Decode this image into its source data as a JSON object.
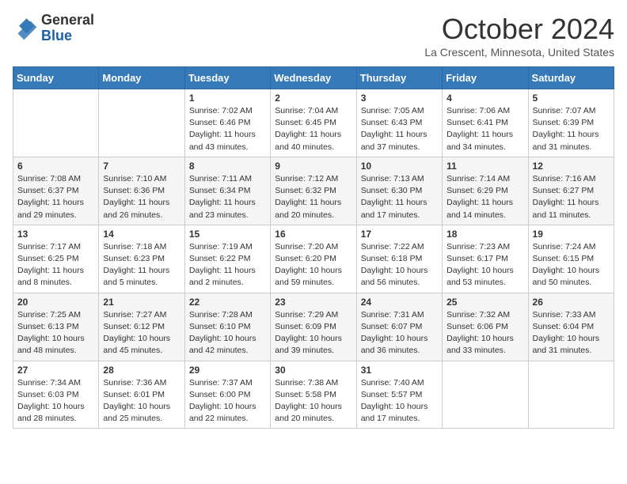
{
  "header": {
    "logo": {
      "line1": "General",
      "line2": "Blue"
    },
    "title": "October 2024",
    "location": "La Crescent, Minnesota, United States"
  },
  "days_of_week": [
    "Sunday",
    "Monday",
    "Tuesday",
    "Wednesday",
    "Thursday",
    "Friday",
    "Saturday"
  ],
  "weeks": [
    [
      {
        "day": "",
        "info": ""
      },
      {
        "day": "",
        "info": ""
      },
      {
        "day": "1",
        "info": "Sunrise: 7:02 AM\nSunset: 6:46 PM\nDaylight: 11 hours and 43 minutes."
      },
      {
        "day": "2",
        "info": "Sunrise: 7:04 AM\nSunset: 6:45 PM\nDaylight: 11 hours and 40 minutes."
      },
      {
        "day": "3",
        "info": "Sunrise: 7:05 AM\nSunset: 6:43 PM\nDaylight: 11 hours and 37 minutes."
      },
      {
        "day": "4",
        "info": "Sunrise: 7:06 AM\nSunset: 6:41 PM\nDaylight: 11 hours and 34 minutes."
      },
      {
        "day": "5",
        "info": "Sunrise: 7:07 AM\nSunset: 6:39 PM\nDaylight: 11 hours and 31 minutes."
      }
    ],
    [
      {
        "day": "6",
        "info": "Sunrise: 7:08 AM\nSunset: 6:37 PM\nDaylight: 11 hours and 29 minutes."
      },
      {
        "day": "7",
        "info": "Sunrise: 7:10 AM\nSunset: 6:36 PM\nDaylight: 11 hours and 26 minutes."
      },
      {
        "day": "8",
        "info": "Sunrise: 7:11 AM\nSunset: 6:34 PM\nDaylight: 11 hours and 23 minutes."
      },
      {
        "day": "9",
        "info": "Sunrise: 7:12 AM\nSunset: 6:32 PM\nDaylight: 11 hours and 20 minutes."
      },
      {
        "day": "10",
        "info": "Sunrise: 7:13 AM\nSunset: 6:30 PM\nDaylight: 11 hours and 17 minutes."
      },
      {
        "day": "11",
        "info": "Sunrise: 7:14 AM\nSunset: 6:29 PM\nDaylight: 11 hours and 14 minutes."
      },
      {
        "day": "12",
        "info": "Sunrise: 7:16 AM\nSunset: 6:27 PM\nDaylight: 11 hours and 11 minutes."
      }
    ],
    [
      {
        "day": "13",
        "info": "Sunrise: 7:17 AM\nSunset: 6:25 PM\nDaylight: 11 hours and 8 minutes."
      },
      {
        "day": "14",
        "info": "Sunrise: 7:18 AM\nSunset: 6:23 PM\nDaylight: 11 hours and 5 minutes."
      },
      {
        "day": "15",
        "info": "Sunrise: 7:19 AM\nSunset: 6:22 PM\nDaylight: 11 hours and 2 minutes."
      },
      {
        "day": "16",
        "info": "Sunrise: 7:20 AM\nSunset: 6:20 PM\nDaylight: 10 hours and 59 minutes."
      },
      {
        "day": "17",
        "info": "Sunrise: 7:22 AM\nSunset: 6:18 PM\nDaylight: 10 hours and 56 minutes."
      },
      {
        "day": "18",
        "info": "Sunrise: 7:23 AM\nSunset: 6:17 PM\nDaylight: 10 hours and 53 minutes."
      },
      {
        "day": "19",
        "info": "Sunrise: 7:24 AM\nSunset: 6:15 PM\nDaylight: 10 hours and 50 minutes."
      }
    ],
    [
      {
        "day": "20",
        "info": "Sunrise: 7:25 AM\nSunset: 6:13 PM\nDaylight: 10 hours and 48 minutes."
      },
      {
        "day": "21",
        "info": "Sunrise: 7:27 AM\nSunset: 6:12 PM\nDaylight: 10 hours and 45 minutes."
      },
      {
        "day": "22",
        "info": "Sunrise: 7:28 AM\nSunset: 6:10 PM\nDaylight: 10 hours and 42 minutes."
      },
      {
        "day": "23",
        "info": "Sunrise: 7:29 AM\nSunset: 6:09 PM\nDaylight: 10 hours and 39 minutes."
      },
      {
        "day": "24",
        "info": "Sunrise: 7:31 AM\nSunset: 6:07 PM\nDaylight: 10 hours and 36 minutes."
      },
      {
        "day": "25",
        "info": "Sunrise: 7:32 AM\nSunset: 6:06 PM\nDaylight: 10 hours and 33 minutes."
      },
      {
        "day": "26",
        "info": "Sunrise: 7:33 AM\nSunset: 6:04 PM\nDaylight: 10 hours and 31 minutes."
      }
    ],
    [
      {
        "day": "27",
        "info": "Sunrise: 7:34 AM\nSunset: 6:03 PM\nDaylight: 10 hours and 28 minutes."
      },
      {
        "day": "28",
        "info": "Sunrise: 7:36 AM\nSunset: 6:01 PM\nDaylight: 10 hours and 25 minutes."
      },
      {
        "day": "29",
        "info": "Sunrise: 7:37 AM\nSunset: 6:00 PM\nDaylight: 10 hours and 22 minutes."
      },
      {
        "day": "30",
        "info": "Sunrise: 7:38 AM\nSunset: 5:58 PM\nDaylight: 10 hours and 20 minutes."
      },
      {
        "day": "31",
        "info": "Sunrise: 7:40 AM\nSunset: 5:57 PM\nDaylight: 10 hours and 17 minutes."
      },
      {
        "day": "",
        "info": ""
      },
      {
        "day": "",
        "info": ""
      }
    ]
  ]
}
